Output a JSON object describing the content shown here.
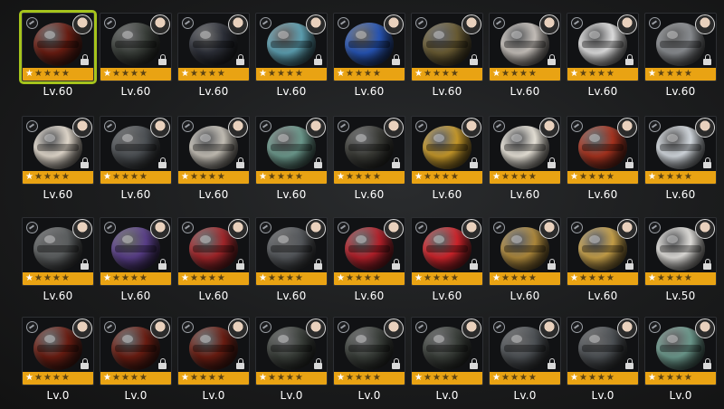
{
  "colors": {
    "background": "#1b1c1d",
    "card": "#111214",
    "star_bar": "#e9a313",
    "selected_outline": "#a6c41c",
    "level_text": "#ffffff"
  },
  "rows": [
    [
      {
        "level": "Lv.60",
        "icon": "red-gauntlet-icon",
        "color": "#6b1d12",
        "selected": true,
        "stars": 1
      },
      {
        "level": "Lv.60",
        "icon": "shark-mouth-orb-icon",
        "color": "#3a3f3a",
        "stars": 1
      },
      {
        "level": "Lv.60",
        "icon": "orca-orb-icon",
        "color": "#2c2f38",
        "stars": 1
      },
      {
        "level": "Lv.60",
        "icon": "crystal-orb-icon",
        "color": "#5ea2b4",
        "stars": 1
      },
      {
        "level": "Lv.60",
        "icon": "blue-dragon-orb-icon",
        "color": "#2756b8",
        "stars": 1
      },
      {
        "level": "Lv.60",
        "icon": "gold-machine-orb-icon",
        "color": "#6a5c33",
        "stars": 1
      },
      {
        "level": "Lv.60",
        "icon": "white-red-helmet-icon",
        "color": "#c9c3bd",
        "stars": 1
      },
      {
        "level": "Lv.60",
        "icon": "glass-orb-icon",
        "color": "#e2e2e2",
        "stars": 1
      },
      {
        "level": "Lv.60",
        "icon": "gray-spiked-orb-icon",
        "color": "#8b8e92",
        "stars": 1
      }
    ],
    [
      {
        "level": "Lv.60",
        "icon": "red-white-orb-icon",
        "color": "#e6ddd0",
        "stars": 1
      },
      {
        "level": "Lv.60",
        "icon": "steel-orb-icon",
        "color": "#4d5155",
        "stars": 1
      },
      {
        "level": "Lv.60",
        "icon": "white-pod-orb-icon",
        "color": "#c7c2b8",
        "stars": 1
      },
      {
        "level": "Lv.60",
        "icon": "zombie-orb-icon",
        "color": "#6d9b8e",
        "stars": 1
      },
      {
        "level": "Lv.60",
        "icon": "dark-armor-orb-icon",
        "color": "#3a3b36",
        "stars": 1
      },
      {
        "level": "Lv.60",
        "icon": "tiger-orb-icon",
        "color": "#c89a2a",
        "stars": 1
      },
      {
        "level": "Lv.60",
        "icon": "pagoda-orb-icon",
        "color": "#ece7dc",
        "stars": 1
      },
      {
        "level": "Lv.60",
        "icon": "red-gold-orb-icon",
        "color": "#a8331f",
        "stars": 1
      },
      {
        "level": "Lv.60",
        "icon": "space-orb-icon",
        "color": "#d7dde3",
        "stars": 1
      }
    ],
    [
      {
        "level": "Lv.60",
        "icon": "gray-red-orb-icon",
        "color": "#5c5f60",
        "stars": 1
      },
      {
        "level": "Lv.60",
        "icon": "purple-crystal-orb-icon",
        "color": "#5a3f8a",
        "stars": 1
      },
      {
        "level": "Lv.60",
        "icon": "red-gear-orb-icon",
        "color": "#a3262a",
        "stars": 1
      },
      {
        "level": "Lv.60",
        "icon": "ink-orb-icon",
        "color": "#55585c",
        "stars": 1
      },
      {
        "level": "Lv.60",
        "icon": "red-gold-ball-icon",
        "color": "#b6202a",
        "stars": 1
      },
      {
        "level": "Lv.60",
        "icon": "apple-orb-icon",
        "color": "#d1242b",
        "stars": 1
      },
      {
        "level": "Lv.60",
        "icon": "gold-skull-orb-icon",
        "color": "#b08a3c",
        "stars": 1
      },
      {
        "level": "Lv.60",
        "icon": "gold-cage-orb-icon",
        "color": "#c9a24a",
        "stars": 1
      },
      {
        "level": "Lv.50",
        "icon": "mech-orb-icon",
        "color": "#e4e2de",
        "stars": 1
      }
    ],
    [
      {
        "level": "Lv.0",
        "icon": "red-gauntlet-icon",
        "color": "#6b1d12",
        "stars": 1
      },
      {
        "level": "Lv.0",
        "icon": "red-gauntlet-icon",
        "color": "#6b1d12",
        "stars": 1
      },
      {
        "level": "Lv.0",
        "icon": "red-gauntlet-icon",
        "color": "#6b1d12",
        "stars": 1
      },
      {
        "level": "Lv.0",
        "icon": "shark-mouth-orb-icon",
        "color": "#3a3f3a",
        "stars": 1
      },
      {
        "level": "Lv.0",
        "icon": "shark-mouth-orb-icon",
        "color": "#3a3f3a",
        "stars": 1
      },
      {
        "level": "Lv.0",
        "icon": "shark-mouth-orb-icon",
        "color": "#3a3f3a",
        "stars": 1
      },
      {
        "level": "Lv.0",
        "icon": "steel-orb-icon",
        "color": "#4d5155",
        "stars": 1
      },
      {
        "level": "Lv.0",
        "icon": "steel-orb-icon",
        "color": "#4d5155",
        "stars": 1
      },
      {
        "level": "Lv.0",
        "icon": "zombie-orb-icon",
        "color": "#6d9b8e",
        "stars": 1
      }
    ]
  ]
}
